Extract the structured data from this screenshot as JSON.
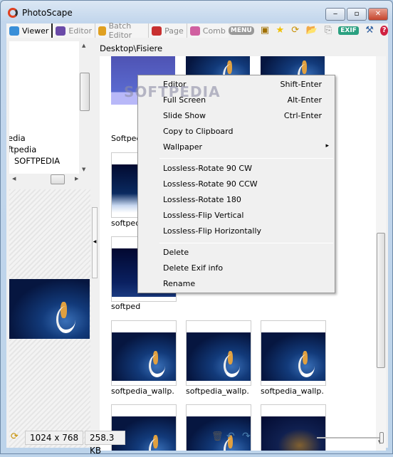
{
  "window": {
    "title": "PhotoScape",
    "minimize": "‒",
    "maximize": "▫",
    "close": "✕"
  },
  "toolbar": {
    "tabs": [
      {
        "label": "Viewer",
        "color": "#3a8fd8"
      },
      {
        "label": "Editor",
        "color": "#6a4aa8"
      },
      {
        "label": "Batch Editor",
        "color": "#e0a020"
      },
      {
        "label": "Page",
        "color": "#c83030"
      },
      {
        "label": "Comb",
        "color": "#d060a0"
      }
    ],
    "menu_label": "MENU",
    "exif_label": "EXIF"
  },
  "tree": {
    "items": [
      "edia",
      "ftpedia",
      "SOFTPEDIA"
    ]
  },
  "path": "Desktop\\Fisiere",
  "thumbnails": [
    {
      "label": "Softped"
    },
    {
      "label": ""
    },
    {
      "label": ""
    },
    {
      "label": "softped"
    },
    {
      "label": "softped"
    },
    {
      "label": "softpedia_wallp..."
    },
    {
      "label": "softpedia_wallp..."
    },
    {
      "label": "softpedia_wallp..."
    },
    {
      "label": ""
    },
    {
      "label": ""
    },
    {
      "label": ""
    }
  ],
  "watermark": "SOFTPEDIA",
  "context_menu": {
    "items": [
      {
        "label": "Editor",
        "shortcut": "Shift-Enter"
      },
      {
        "label": "Full Screen",
        "shortcut": "Alt-Enter"
      },
      {
        "label": "Slide Show",
        "shortcut": "Ctrl-Enter"
      },
      {
        "label": "Copy to Clipboard"
      },
      {
        "label": "Wallpaper",
        "submenu": "▸"
      },
      {
        "label": "Lossless-Rotate 90 CW"
      },
      {
        "label": "Lossless-Rotate 90 CCW"
      },
      {
        "label": "Lossless-Rotate 180"
      },
      {
        "label": "Lossless-Flip Vertical"
      },
      {
        "label": "Lossless-Flip Horizontally"
      },
      {
        "label": "Delete"
      },
      {
        "label": "Delete Exif info"
      },
      {
        "label": "Rename"
      }
    ]
  },
  "status": {
    "dimensions": "1024 x 768",
    "size": "258.3 KB",
    "zoom_slider": 1.0
  }
}
